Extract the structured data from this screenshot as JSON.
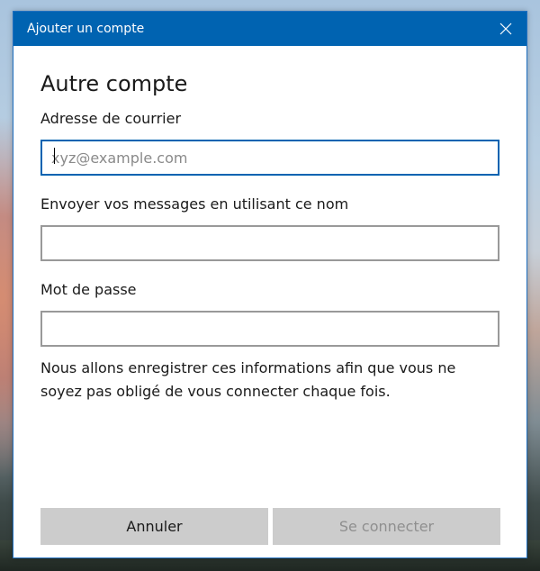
{
  "window": {
    "title": "Ajouter un compte"
  },
  "form": {
    "heading": "Autre compte",
    "email_label": "Adresse de courrier",
    "email_placeholder": "xyz@example.com",
    "email_value": "",
    "name_label": "Envoyer vos messages en utilisant ce nom",
    "name_value": "",
    "password_label": "Mot de passe",
    "password_value": "",
    "info_text": "Nous allons enregistrer ces informations afin que vous ne soyez pas obligé de vous connecter chaque fois."
  },
  "buttons": {
    "cancel_label": "Annuler",
    "connect_label": "Se connecter"
  },
  "colors": {
    "accent": "#0063b1",
    "button_bg": "#cccccc",
    "disabled_text": "#8f8f8f"
  },
  "icons": {
    "close": "close-icon"
  }
}
